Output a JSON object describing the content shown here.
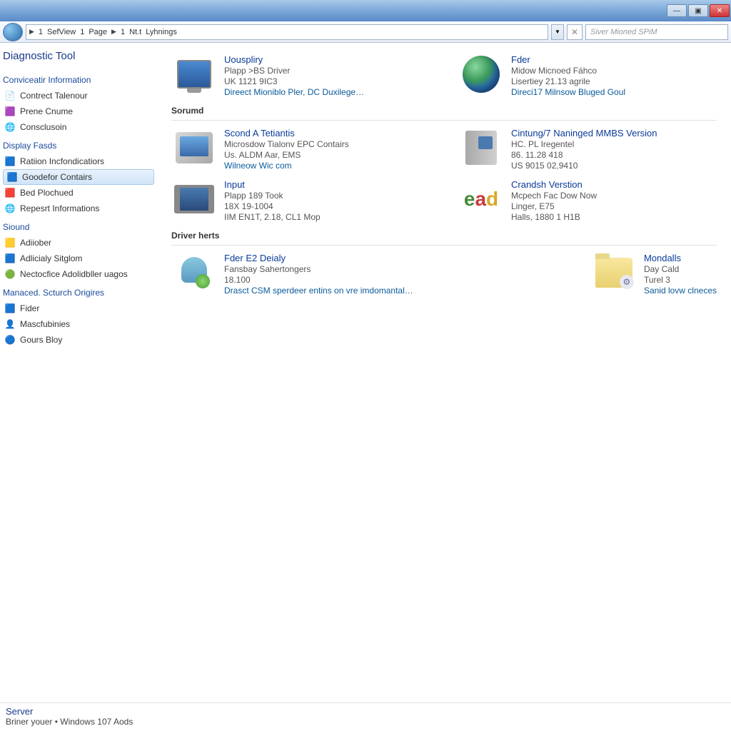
{
  "titlebar": {
    "min": "—",
    "max": "▣",
    "close": "✕"
  },
  "toolbar": {
    "crumbs": [
      "1",
      "SefView",
      "1",
      "Page",
      "1",
      "Nt.t",
      "Lyhnings"
    ],
    "clear": "✕",
    "search_placeholder": "Siver Mioned SPiM"
  },
  "sidebar": {
    "title": "Diagnostic Tool",
    "groups": [
      {
        "heading": "Conviceatir Information",
        "items": [
          {
            "icon": "📄",
            "label": "Contrect Talenour"
          },
          {
            "icon": "🟪",
            "label": "Prene Cnume"
          },
          {
            "icon": "🌐",
            "label": "Consclusoin"
          }
        ]
      },
      {
        "heading": "Display Fasds",
        "items": [
          {
            "icon": "🟦",
            "label": "Ratiion Incfondicatiors"
          },
          {
            "icon": "🟦",
            "label": "Goodefor Contairs",
            "selected": true
          },
          {
            "icon": "🟥",
            "label": "Bed Plochued"
          },
          {
            "icon": "🌐",
            "label": "Repesrt Informations"
          }
        ]
      },
      {
        "heading": "Siound",
        "items": [
          {
            "icon": "🟨",
            "label": "Adiiober"
          },
          {
            "icon": "🟦",
            "label": "Adlicialy Sitglom"
          },
          {
            "icon": "🟢",
            "label": "Nectocfice Adolidbller uagos"
          }
        ]
      },
      {
        "heading": "Manaced. Scturch Origires",
        "items": [
          {
            "icon": "🟦",
            "label": "Fider"
          },
          {
            "icon": "👤",
            "label": "Mascfubinies"
          },
          {
            "icon": "🔵",
            "label": "Gours Bloy"
          }
        ]
      }
    ]
  },
  "content": {
    "rows": [
      {
        "left": {
          "title": "Uouspliry",
          "l1": "Plapp >BS Driver",
          "l2": "UK 1121 9IC3",
          "link": "Direect Mioniblo Pler, DC Duxilege…"
        },
        "right": {
          "title": "Fder",
          "l1": "Midow Micnoed Fáhco",
          "l2": "Lisertiey 21.13 agrile",
          "link": "Direci17 Milnsow Bluged Goul"
        }
      },
      {
        "label": "Sorumd",
        "left": {
          "title": "Scond A Tetiantis",
          "l1": "Microsdow Tialonv EPC Contairs",
          "l2": "Us. ALDM Aar, EMS",
          "link": "Wilneow Wic com"
        },
        "right": {
          "title": "Cintung/7 Naninged MMBS Version",
          "l1": "HC. PL Iregentel",
          "l2": "86. 11.28 418",
          "l3": "US 9015 02,9410"
        }
      },
      {
        "left": {
          "title": "Input",
          "l1": "Plapp 189 Took",
          "l2": "18X 19-1004",
          "l3": "IIM EN1T, 2.18, CL1 Mop"
        },
        "right": {
          "title": "Crandsh Verstion",
          "l1": "Mcpech Fac Dow Now",
          "l2": "Linger, E75",
          "l3": "Halls, 1880 1 H1B"
        }
      },
      {
        "label": "Driver herts",
        "left": {
          "title": "Fder E2 Deialy",
          "l1": "Fansbay Sahertongers",
          "l2": "18.100",
          "link": "Drasct CSM sperdeer entins on vre imdomantal…"
        },
        "right": {
          "title": "Mondalls",
          "l1": "Day Cald",
          "l2": "Turel 3",
          "link": "Sanid lovw clneces"
        }
      }
    ]
  },
  "footer": {
    "l1": "Server",
    "l2a": "Briner youer",
    "sep": "•",
    "l2b": "Windows 107 Aods"
  }
}
